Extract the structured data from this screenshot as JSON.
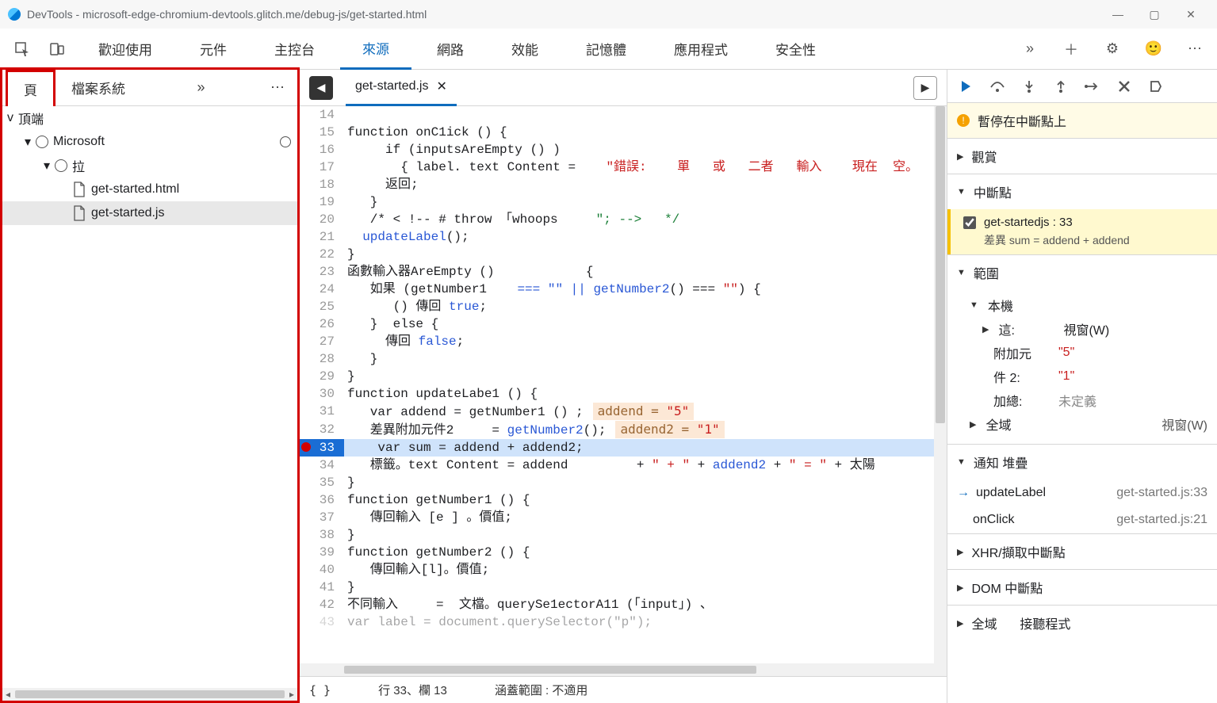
{
  "window": {
    "title": "DevTools - microsoft-edge-chromium-devtools.glitch.me/debug-js/get-started.html"
  },
  "mainTabs": {
    "welcome": "歡迎使用",
    "elements": "元件",
    "console": "主控台",
    "sources": "來源",
    "network": "網路",
    "performance": "效能",
    "memory": "記憶體",
    "application": "應用程式",
    "security": "安全性"
  },
  "sidePanel": {
    "page": "頁",
    "filesystem": "檔案系統",
    "top": "頂端",
    "domain": "Microsoft",
    "folder": "拉",
    "file_html": "get-started.html",
    "file_js": "get-started.js"
  },
  "editor": {
    "filename": "get-started.js",
    "hint1_label": "addend = ",
    "hint1_value": "\"5\"",
    "hint2_label": "addend2 = ",
    "hint2_value": "\"1\"",
    "lines": {
      "l14": "",
      "l15": "function onC1ick () {",
      "l16": "     if (inputsAreEmpty () )",
      "l17a": "       { label. text Content =    ",
      "l17b": "\"錯誤:    單   或   二者   輸入    現在  空。",
      "l18": "     返回;",
      "l19": "   }",
      "l20a": "   /* < !-- # throw 「whoops     ",
      "l20b": "\"; -->   */",
      "l21a": "  updateLabel",
      "l21b": "();",
      "l22": "}",
      "l23": "函數輸入器AreEmpty ()            {",
      "l24a": "   如果 (getNumber1    ",
      "l24b": "=== \"\" || ",
      "l24c": "getNumber2",
      "l24d": "() === ",
      "l24e": "\"\"",
      "l24f": ") {",
      "l25a": "      () 傳回 ",
      "l25b": "true",
      "l25c": ";",
      "l26": "   }  else {",
      "l27a": "     傳回 ",
      "l27b": "false",
      "l27c": ";",
      "l28": "   }",
      "l29": "}",
      "l30": "function updateLabe1 () {",
      "l31": "   var addend = getNumber1 () ;",
      "l32a": "   差異附加元件2     = ",
      "l32b": "getNumber2",
      "l32c": "();",
      "l33": "    var sum = addend + addend2;",
      "l34a": "   標籤。text Content = addend         + ",
      "l34b": "\" + \"",
      "l34c": " + ",
      "l34d": "addend2",
      "l34e": " + ",
      "l34f": "\" = \"",
      "l34g": " + 太陽",
      "l35": "}",
      "l36": "function getNumber1 () {",
      "l37": "   傳回輸入 [e ] 。價值;",
      "l38": "}",
      "l39": "function getNumber2 () {",
      "l40": "   傳回輸入[l]。價值;",
      "l41": "}",
      "l42": "不同輸入     =  文檔。querySe1ectorA11 (「input」) 、",
      "l43": "var label = document.querySelector(\"p\");"
    },
    "status_line": "行 33、欄 13",
    "status_cov": "涵蓋範圍 : 不適用"
  },
  "debugger": {
    "paused": "暫停在中斷點上",
    "watch": "觀賞",
    "breakpoints": "中斷點",
    "bp_label": "get-startedjs : 33",
    "bp_detail": "差異 sum = addend + addend",
    "scope": "範圍",
    "local": "本機",
    "this_lbl": "這:",
    "this_val": "視窗(W)",
    "addend_lbl": "附加元",
    "addend_val": "\"5\"",
    "addend2_lbl": "件 2:",
    "addend2_val": "\"1\"",
    "sum_lbl": "加總:",
    "sum_val": "未定義",
    "global": "全域",
    "global_val": "視窗(W)",
    "callstack": "通知 堆疊",
    "cs1_fn": "updateLabel",
    "cs1_loc": "get-started.js:33",
    "cs2_fn": "onClick",
    "cs2_loc": "get-started.js:21",
    "xhr": "XHR/擷取中斷點",
    "dom": "DOM 中斷點",
    "global2": "全域",
    "listeners": "接聽程式"
  }
}
